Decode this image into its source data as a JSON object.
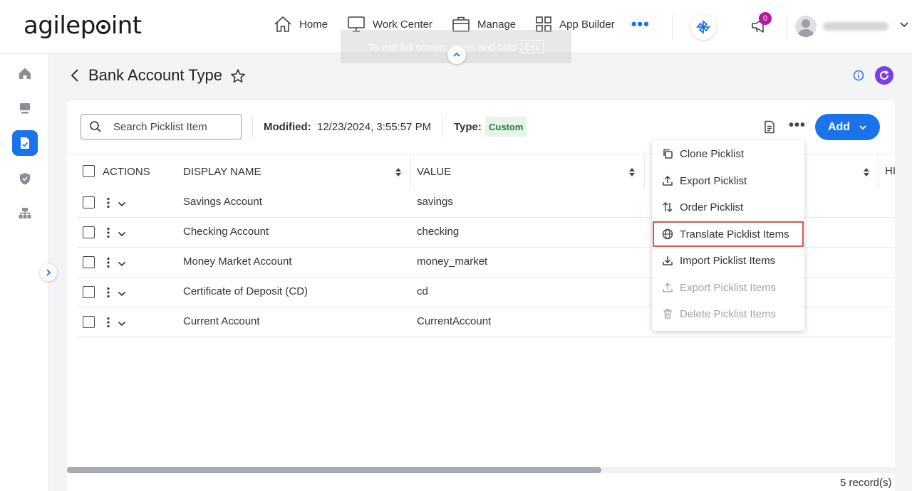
{
  "brand": {
    "logo_text_before": "agilep",
    "logo_text_after": "int"
  },
  "nav": {
    "items": [
      {
        "label": "Home",
        "icon": "home-icon"
      },
      {
        "label": "Work Center",
        "icon": "monitor-icon"
      },
      {
        "label": "Manage",
        "icon": "briefcase-icon"
      },
      {
        "label": "App Builder",
        "icon": "grid-icon"
      }
    ],
    "more": "•••"
  },
  "notifications": {
    "count": "0"
  },
  "toast": {
    "text": "To exit full screen, press and hold",
    "key": "Esc"
  },
  "page": {
    "title": "Bank Account Type"
  },
  "toolbar": {
    "search_placeholder": "Search Picklist Item",
    "modified_label": "Modified:",
    "modified_value": "12/23/2024, 3:55:57 PM",
    "type_label": "Type:",
    "type_value": "Custom",
    "more": "•••",
    "add_label": "Add"
  },
  "table": {
    "headers": {
      "actions": "ACTIONS",
      "display_name": "DISPLAY NAME",
      "value": "VALUE",
      "hidden": "HI"
    },
    "rows": [
      {
        "display_name": "Savings Account",
        "value": "savings"
      },
      {
        "display_name": "Checking Account",
        "value": "checking"
      },
      {
        "display_name": "Money Market Account",
        "value": "money_market"
      },
      {
        "display_name": "Certificate of Deposit (CD)",
        "value": "cd"
      },
      {
        "display_name": "Current Account",
        "value": "CurrentAccount"
      }
    ]
  },
  "menu": {
    "items": [
      {
        "label": "Clone Picklist",
        "icon": "clone-icon",
        "state": "enabled"
      },
      {
        "label": "Export Picklist",
        "icon": "export-icon",
        "state": "enabled"
      },
      {
        "label": "Order Picklist",
        "icon": "sort-icon",
        "state": "enabled"
      },
      {
        "label": "Translate Picklist Items",
        "icon": "globe-icon",
        "state": "highlighted"
      },
      {
        "label": "Import Picklist Items",
        "icon": "import-icon",
        "state": "enabled"
      },
      {
        "label": "Export Picklist Items",
        "icon": "export-icon",
        "state": "disabled"
      },
      {
        "label": "Delete Picklist Items",
        "icon": "trash-icon",
        "state": "disabled"
      }
    ]
  },
  "footer": {
    "records": "5 record(s)"
  },
  "colors": {
    "accent": "#1a73e8",
    "refresh": "#7b3fe4",
    "badge": "#b5179e",
    "type_badge_bg": "#e6f4ea",
    "highlight": "#d9534f"
  }
}
